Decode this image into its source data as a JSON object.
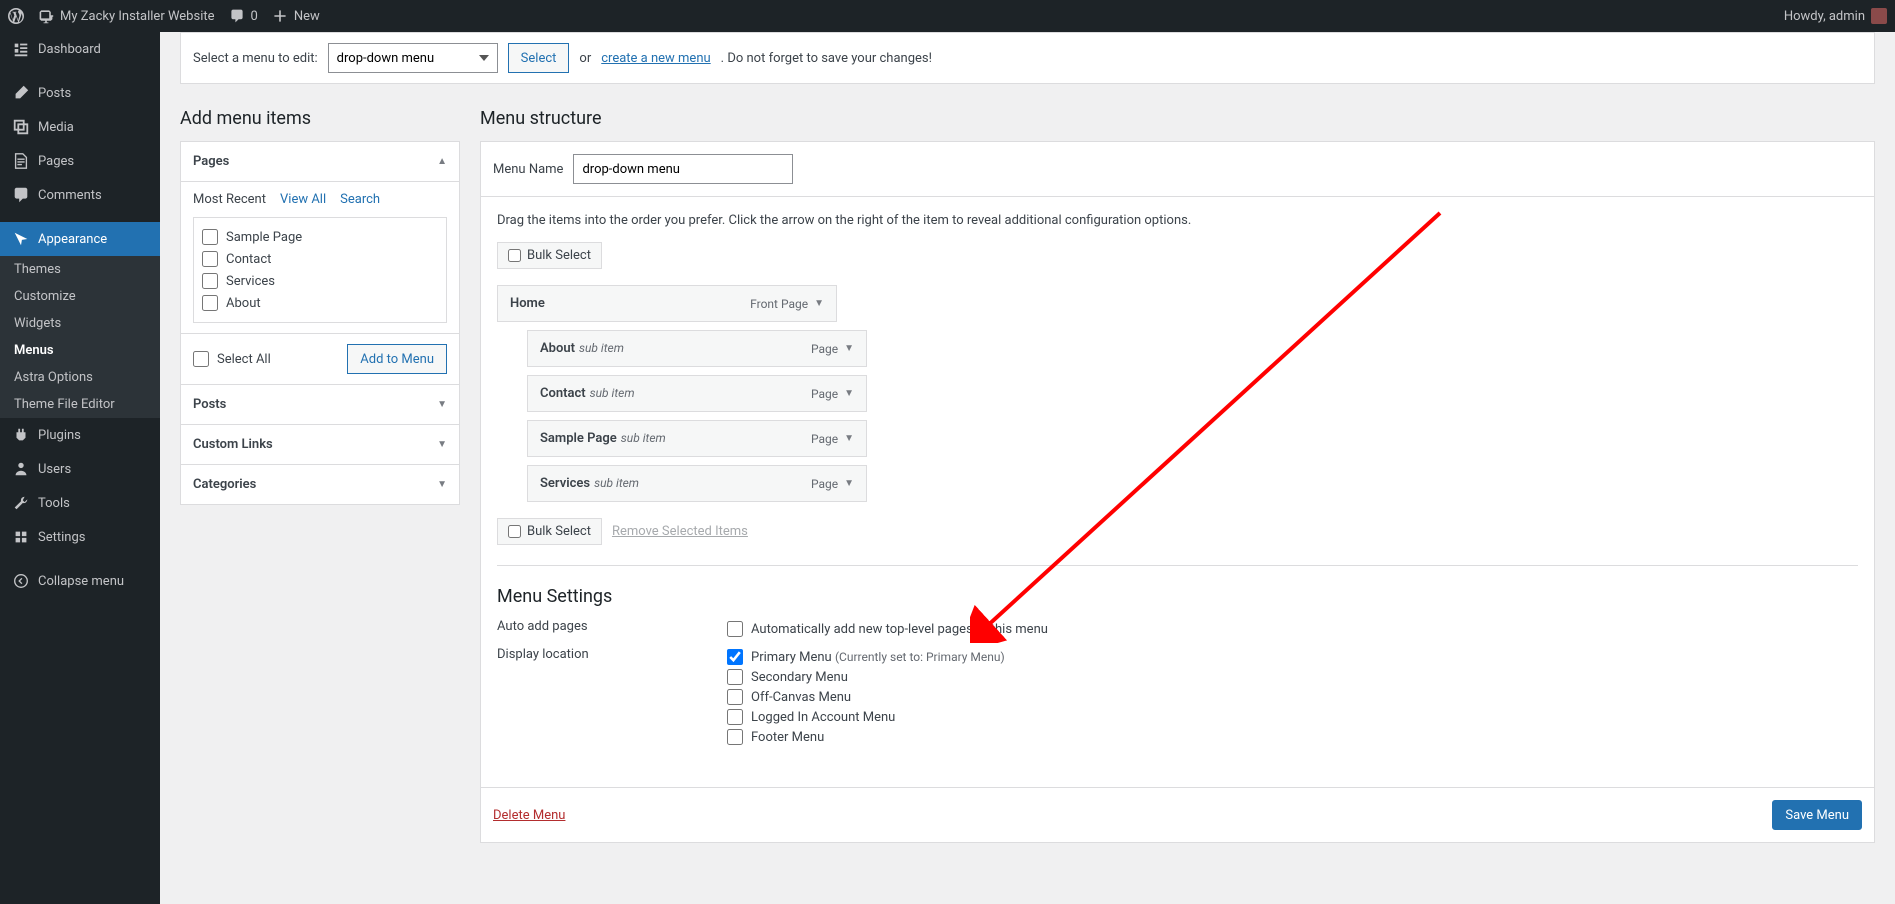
{
  "adminbar": {
    "site_name": "My Zacky Installer Website",
    "comments_count": "0",
    "new_label": "New",
    "howdy": "Howdy, admin"
  },
  "sidebar": {
    "items": [
      {
        "label": "Dashboard"
      },
      {
        "label": "Posts"
      },
      {
        "label": "Media"
      },
      {
        "label": "Pages"
      },
      {
        "label": "Comments"
      },
      {
        "label": "Appearance"
      },
      {
        "label": "Plugins"
      },
      {
        "label": "Users"
      },
      {
        "label": "Tools"
      },
      {
        "label": "Settings"
      },
      {
        "label": "Collapse menu"
      }
    ],
    "submenu": [
      {
        "label": "Themes"
      },
      {
        "label": "Customize"
      },
      {
        "label": "Widgets"
      },
      {
        "label": "Menus"
      },
      {
        "label": "Astra Options"
      },
      {
        "label": "Theme File Editor"
      }
    ]
  },
  "edit_bar": {
    "label": "Select a menu to edit:",
    "selected": "drop-down menu",
    "select_btn": "Select",
    "or": "or",
    "create_link": "create a new menu",
    "suffix": ". Do not forget to save your changes!"
  },
  "left": {
    "heading": "Add menu items",
    "pages_title": "Pages",
    "tabs": [
      "Most Recent",
      "View All",
      "Search"
    ],
    "page_items": [
      "Sample Page",
      "Contact",
      "Services",
      "About"
    ],
    "select_all": "Select All",
    "add_btn": "Add to Menu",
    "sections": [
      "Posts",
      "Custom Links",
      "Categories"
    ]
  },
  "right": {
    "heading": "Menu structure",
    "name_label": "Menu Name",
    "menu_name": "drop-down menu",
    "drag_hint": "Drag the items into the order you prefer. Click the arrow on the right of the item to reveal additional configuration options.",
    "bulk_select": "Bulk Select",
    "remove_selected": "Remove Selected Items",
    "items": [
      {
        "title": "Home",
        "sub": "",
        "type": "Front Page",
        "indent": false
      },
      {
        "title": "About",
        "sub": "sub item",
        "type": "Page",
        "indent": true
      },
      {
        "title": "Contact",
        "sub": "sub item",
        "type": "Page",
        "indent": true
      },
      {
        "title": "Sample Page",
        "sub": "sub item",
        "type": "Page",
        "indent": true
      },
      {
        "title": "Services",
        "sub": "sub item",
        "type": "Page",
        "indent": true
      }
    ],
    "settings_heading": "Menu Settings",
    "auto_add_label": "Auto add pages",
    "auto_add_option": "Automatically add new top-level pages to this menu",
    "display_label": "Display location",
    "locations": [
      {
        "label": "Primary Menu",
        "note": "(Currently set to: Primary Menu)",
        "checked": true
      },
      {
        "label": "Secondary Menu",
        "checked": false
      },
      {
        "label": "Off-Canvas Menu",
        "checked": false
      },
      {
        "label": "Logged In Account Menu",
        "checked": false
      },
      {
        "label": "Footer Menu",
        "checked": false
      }
    ],
    "delete": "Delete Menu",
    "save": "Save Menu"
  }
}
